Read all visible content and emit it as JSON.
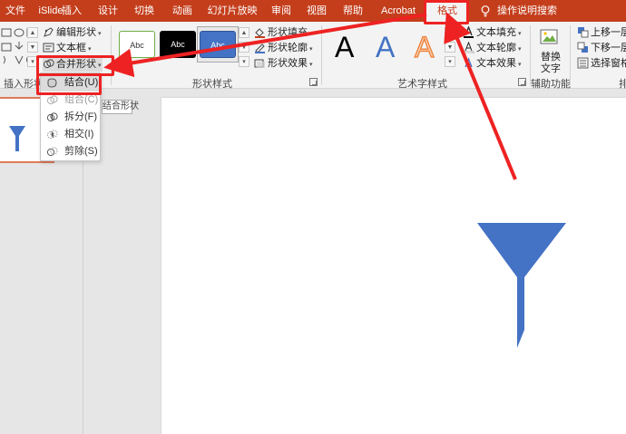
{
  "tabs": [
    {
      "label": "文件"
    },
    {
      "label": "iSlide"
    },
    {
      "label": "插入"
    },
    {
      "label": "设计"
    },
    {
      "label": "切换"
    },
    {
      "label": "动画"
    },
    {
      "label": "幻灯片放映"
    },
    {
      "label": "审阅"
    },
    {
      "label": "视图"
    },
    {
      "label": "帮助"
    },
    {
      "label": "Acrobat"
    },
    {
      "label": "格式"
    }
  ],
  "tell_me": "操作说明搜索",
  "ribbon": {
    "insert_shapes": {
      "label": "插入形状",
      "edit_shape": "编辑形状",
      "text_box": "文本框",
      "merge_shapes": "合并形状"
    },
    "shape_styles": {
      "label": "形状样式",
      "swatch_text": "Abc",
      "fill": "形状填充",
      "outline": "形状轮廓",
      "effects": "形状效果"
    },
    "wordart": {
      "label": "艺术字样式",
      "sample_letter": "A",
      "text_fill": "文本填充",
      "text_outline": "文本轮廓",
      "text_effects": "文本效果"
    },
    "accessibility": {
      "label": "辅助功能",
      "alt_text_line1": "替换",
      "alt_text_line2": "文字"
    },
    "arrange": {
      "label": "排",
      "bring_forward": "上移一层",
      "send_backward": "下移一层",
      "selection_pane": "选择窗格"
    }
  },
  "merge_menu": {
    "items": [
      {
        "label": "结合(U)"
      },
      {
        "label": "组合(C)"
      },
      {
        "label": "拆分(F)"
      },
      {
        "label": "相交(I)"
      },
      {
        "label": "剪除(S)"
      }
    ],
    "tooltip": "结合形状"
  },
  "colors": {
    "accent": "#c43e1c",
    "shape_fill": "#4472c4",
    "annotation": "#ee2222"
  }
}
